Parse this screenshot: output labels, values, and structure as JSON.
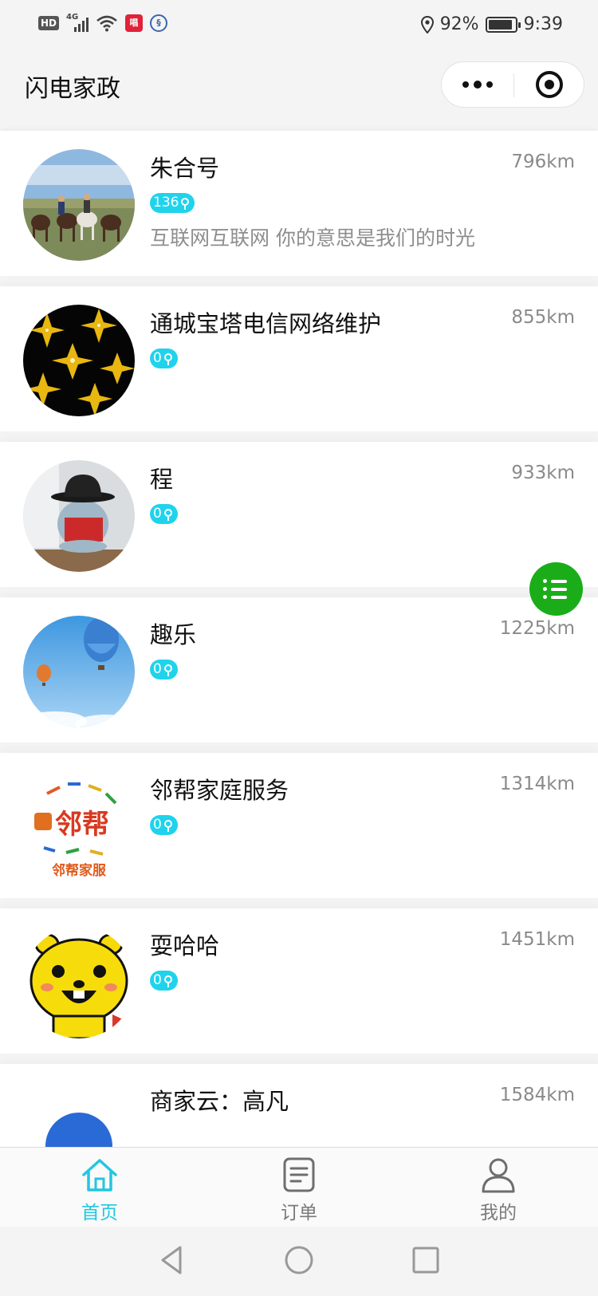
{
  "status_bar": {
    "hd": "HD",
    "network": "4G",
    "app_red_icon": "唱",
    "app_blue_icon": "§",
    "battery_percent": "92%",
    "battery_level": 0.92,
    "time": "9:39"
  },
  "nav": {
    "title": "闪电家政"
  },
  "shops": [
    {
      "name": "朱合号",
      "distance": "796km",
      "badge": "136",
      "desc": "互联网互联网 你的意思是我们的时光",
      "avatar": "horses-photo"
    },
    {
      "name": "通城宝塔电信网络维护",
      "distance": "855km",
      "badge": "0",
      "desc": "",
      "avatar": "sparkle-stars"
    },
    {
      "name": "程",
      "distance": "933km",
      "badge": "0",
      "desc": "",
      "avatar": "toy-bowler-hat"
    },
    {
      "name": "趣乐",
      "distance": "1225km",
      "badge": "0",
      "desc": "",
      "avatar": "hot-air-balloons"
    },
    {
      "name": "邻帮家庭服务",
      "distance": "1314km",
      "badge": "0",
      "desc": "",
      "avatar": "linbang-logo",
      "avatar_logo_text": "邻帮",
      "avatar_logo_subtext": "邻帮家服"
    },
    {
      "name": "耍哈哈",
      "distance": "1451km",
      "badge": "0",
      "desc": "",
      "avatar": "yellow-cartoon"
    },
    {
      "name": "商家云：高凡",
      "distance": "1584km",
      "badge": "",
      "desc": "",
      "avatar": "blue-circle"
    }
  ],
  "tabbar": {
    "home": "首页",
    "orders": "订单",
    "mine": "我的"
  },
  "colors": {
    "accent": "#22c6e0",
    "badge": "#1fd3ec",
    "fab": "#1aad19"
  },
  "icons": {
    "fab": "list-icon",
    "home": "home-icon",
    "orders": "document-icon",
    "mine": "user-icon"
  }
}
